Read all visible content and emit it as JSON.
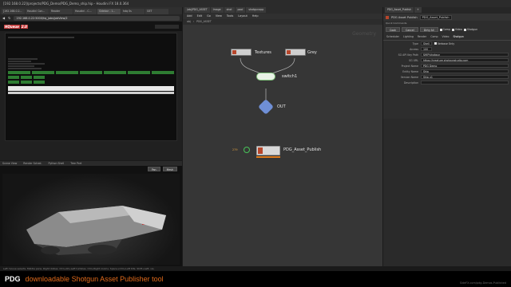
{
  "window": {
    "title": "[192.168.0.22]/projects/PDG_Demo/PDG_Demo_ship.hip - Houdini FX 18.0.364"
  },
  "browser": {
    "tabs": [
      "[192.168.0.2...",
      "Houdini Con...",
      "Reader",
      "Houdini - C...",
      "Sidebar - 1...",
      "hdq 0s",
      "GET",
      "Perforce",
      "Dock Ex..."
    ],
    "url": "192.168.0.22:5000/hq_jobs/jobView/2",
    "logo": "HQueue",
    "logo_badge": "2.0"
  },
  "render_panel": {
    "tabs": [
      "Scene View",
      "Render Sched.",
      "Python Shell",
      "Tree Port"
    ],
    "buttons": [
      "Pan",
      "Mesh"
    ]
  },
  "graph": {
    "tabs": [
      "/obj/PDG_ASSET",
      "Image",
      "shot",
      "pool",
      "shotgunapp"
    ],
    "menu": [
      "Add",
      "Edit",
      "Go",
      "View",
      "Tools",
      "Layout",
      "Help"
    ],
    "path": [
      "obj",
      "PDG_ASSET"
    ],
    "watermark": "Geometry",
    "nodes": {
      "textures": "Textures",
      "grey": "Grey",
      "switch": "switch1",
      "out": "OUT",
      "publish": "PDG_Asset_Publish",
      "publish_count": "279"
    }
  },
  "params": {
    "tabs": [
      "PDG_Asset_Publish",
      "+"
    ],
    "node_type": "PDG Asset Publish",
    "node_name": "PDG_Asset_Publish",
    "quick_commands": "Quick Commands",
    "buttons": [
      "Cook",
      "Cancel",
      "Dirty All"
    ],
    "checks": [
      "Comp",
      "Video",
      "Shotgun"
    ],
    "sections": [
      "Scheduler",
      "Lighting",
      "Render",
      "Comp",
      "Video",
      "Shotgun"
    ],
    "type_label": "Type",
    "type_value": "Shell",
    "verbose": "Verbose Only",
    "access_label": "Access",
    "access_value": "100",
    "fields": [
      {
        "label": "SG API Key Path",
        "value": "$HIP/shotgun"
      },
      {
        "label": "SG URL",
        "value": "https://creature.shotgunstudio.com"
      },
      {
        "label": "Project Name",
        "value": "PDG Demo"
      },
      {
        "label": "Entity Name",
        "value": "Ship"
      },
      {
        "label": "Version Name",
        "value": "Ship v1"
      },
      {
        "label": "Description",
        "value": ""
      }
    ]
  },
  "status": "Left mouse selects. Middle pans. Right dollies. Ctrl+Alt+Left tumbles. Ctrl+Right zooms. Space+Ctrl+Left tilts. Shift+Left, vis.",
  "banner": {
    "brand": "PDG",
    "subtitle": "downloadable Shotgun Asset Publisher tool",
    "credit": "SideFX.com/pdg-Demos-Published"
  },
  "colors": {
    "accent_orange": "#e06a1b",
    "hq_blue": "#5ab3ff",
    "node_green": "#48c45a"
  }
}
